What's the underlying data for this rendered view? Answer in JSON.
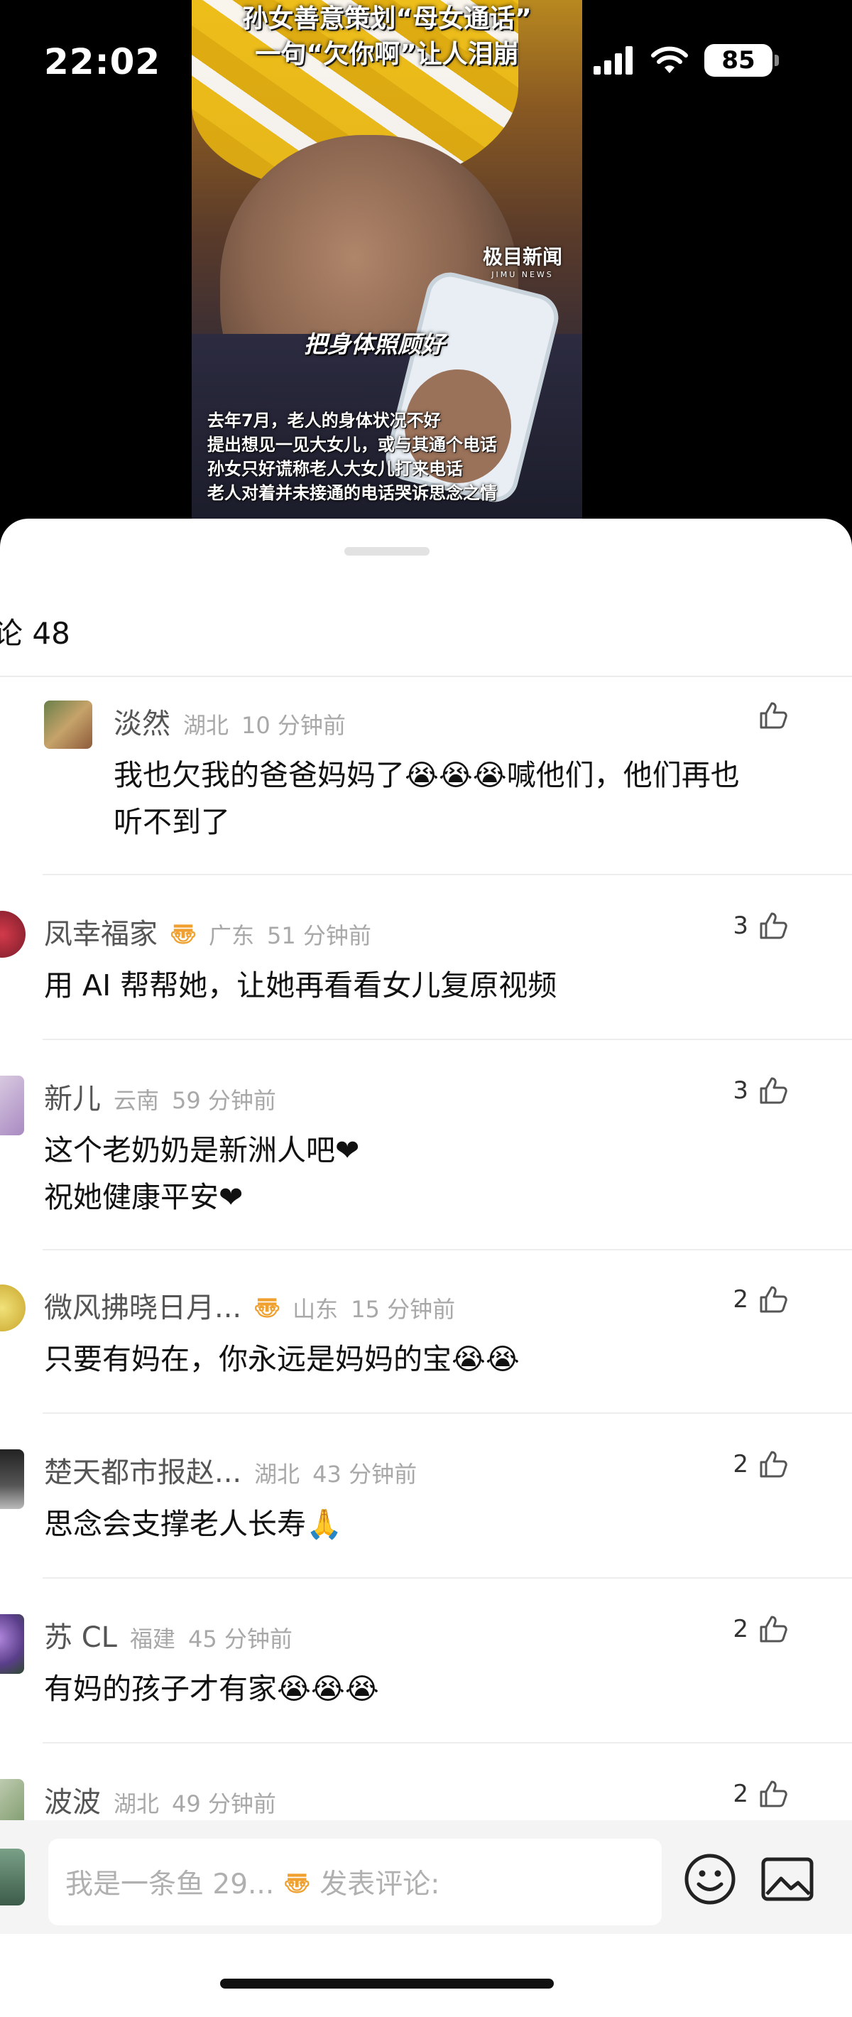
{
  "status_bar": {
    "time": "22:02",
    "battery": "85"
  },
  "video": {
    "title_line1": "孙女善意策划“母女通话”",
    "title_line2": "一句“欠你啊”让人泪崩",
    "logo": "极目新闻",
    "logo_sub": "JIMU NEWS",
    "caption": "把身体照顾好",
    "lines": [
      "去年7月，老人的身体状况不好",
      "提出想见一见大女儿，或与其通个电话",
      "孙女只好谎称老人大女儿打来电话",
      "老人对着并未接通的电话哭诉思念之情"
    ]
  },
  "comments_header": {
    "title": "论 48"
  },
  "comments": [
    {
      "name": "淡然",
      "badge": "",
      "location": "湖北",
      "time": "10 分钟前",
      "likes": "",
      "text_lines": [
        "我也欠我的爸爸妈妈了😭😭😭喊他们，他们再也",
        "听不到了"
      ]
    },
    {
      "name": "凤幸福家",
      "badge": "〠",
      "location": "广东",
      "time": "51 分钟前",
      "likes": "3",
      "text_lines": [
        "用 AI 帮帮她，让她再看看女儿复原视频"
      ]
    },
    {
      "name": "新儿",
      "badge": "",
      "location": "云南",
      "time": "59 分钟前",
      "likes": "3",
      "text_lines": [
        "这个老奶奶是新洲人吧❤",
        "祝她健康平安❤"
      ]
    },
    {
      "name": "微风拂晓日月...",
      "badge": "〠",
      "location": "山东",
      "time": "15 分钟前",
      "likes": "2",
      "text_lines": [
        "只要有妈在，你永远是妈妈的宝😭😭"
      ]
    },
    {
      "name": "楚天都市报赵...",
      "badge": "",
      "location": "湖北",
      "time": "43 分钟前",
      "likes": "2",
      "text_lines": [
        "思念会支撑老人长寿🙏"
      ]
    },
    {
      "name": "苏 CL",
      "badge": "",
      "location": "福建",
      "time": "45 分钟前",
      "likes": "2",
      "text_lines": [
        "有妈的孩子才有家😭😭😭"
      ]
    },
    {
      "name": "波波",
      "badge": "",
      "location": "湖北",
      "time": "49 分钟前",
      "likes": "2",
      "text_lines": []
    }
  ],
  "input_bar": {
    "placeholder_user": "我是一条鱼 29...",
    "placeholder_badge": "〠",
    "placeholder_action": "发表评论:"
  },
  "icons": {
    "like": "thumbs-up-icon",
    "emoji": "smiley-icon",
    "image": "image-icon",
    "signal": "signal-icon",
    "wifi": "wifi-icon",
    "battery": "battery-icon"
  },
  "colors": {
    "badge": "#f0a02e",
    "meta_gray": "#a8a8a8",
    "name_gray": "#555555",
    "text": "#111111"
  }
}
